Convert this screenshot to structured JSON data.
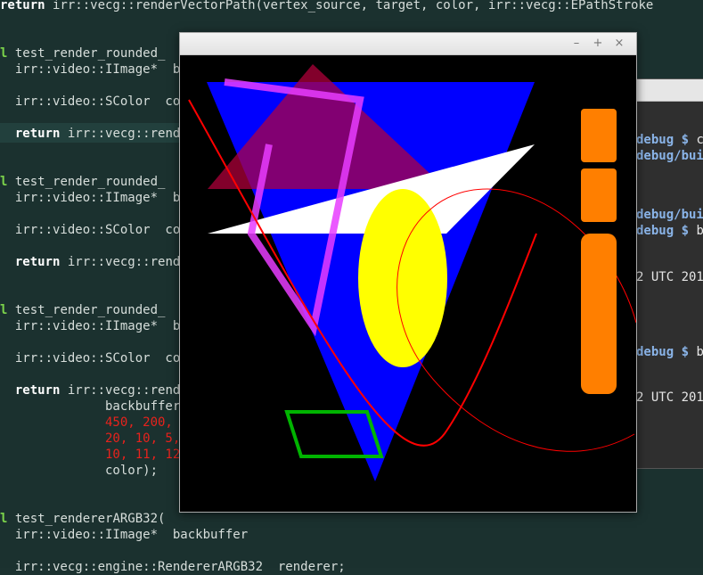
{
  "editor": {
    "lines": [
      {
        "parts": [
          {
            "cls": "kw",
            "text": "return"
          },
          {
            "text": " irr::vecg::renderVectorPath(vertex_source, target, color, irr::vecg::EPathStroke"
          }
        ]
      },
      {
        "parts": [
          {
            "cls": "kw-green",
            "text": "l"
          },
          {
            "text": " test_render_rounded_"
          }
        ]
      },
      {
        "parts": [
          {
            "text": "  irr::video::IImage*  b"
          }
        ]
      },
      {
        "parts": [
          {
            "text": "  irr::video::SColor  co"
          }
        ]
      },
      {
        "parts": [
          {
            "cls": "kw",
            "text": "  return"
          },
          {
            "text": " irr::vecg::rend"
          }
        ]
      },
      {
        "parts": [
          {
            "cls": "kw-green",
            "text": "l"
          },
          {
            "text": " test_render_rounded_"
          }
        ]
      },
      {
        "parts": [
          {
            "text": "  irr::video::IImage*  b"
          }
        ]
      },
      {
        "parts": [
          {
            "text": "  irr::video::SColor  co"
          }
        ]
      },
      {
        "parts": [
          {
            "cls": "kw",
            "text": "  return"
          },
          {
            "text": " irr::vecg::rend"
          }
        ]
      },
      {
        "parts": [
          {
            "cls": "kw-green",
            "text": "l"
          },
          {
            "text": " test_render_rounded_"
          }
        ]
      },
      {
        "parts": [
          {
            "text": "  irr::video::IImage*  b"
          }
        ]
      },
      {
        "parts": [
          {
            "text": "  irr::video::SColor  co"
          }
        ]
      },
      {
        "parts": [
          {
            "cls": "kw",
            "text": "  return"
          },
          {
            "text": " irr::vecg::rend"
          }
        ]
      },
      {
        "parts": [
          {
            "text": "              backbuffer"
          }
        ]
      },
      {
        "parts": [
          {
            "cls": "num",
            "text": "              450, 200,"
          }
        ]
      },
      {
        "parts": [
          {
            "cls": "num",
            "text": "              20, 10, 5,"
          }
        ]
      },
      {
        "parts": [
          {
            "cls": "num",
            "text": "              10, 11, 12"
          }
        ]
      },
      {
        "parts": [
          {
            "text": "              color);"
          }
        ]
      },
      {
        "parts": [
          {
            "cls": "kw-green",
            "text": "l"
          },
          {
            "text": " test_rendererARGB32("
          }
        ]
      },
      {
        "parts": [
          {
            "text": "  irr::video::IImage*  backbuffer"
          }
        ]
      },
      {
        "parts": [
          {
            "text": "  irr::vecg::engine::RendererARGB32  renderer;"
          }
        ]
      }
    ]
  },
  "terminal": {
    "lines": [
      {
        "path": "debug $ ",
        "text": "cd"
      },
      {
        "path": "debug/buil",
        "text": ""
      },
      {
        "path": "debug/buil",
        "text": ""
      },
      {
        "path": "debug $ ",
        "text": "bi"
      },
      {
        "path": "",
        "text": "2 UTC 201"
      },
      {
        "path": "debug $ ",
        "text": "bi"
      },
      {
        "path": "",
        "text": "2 UTC 201"
      }
    ]
  },
  "window": {
    "minimize_glyph": "–",
    "maximize_glyph": "+",
    "close_glyph": "×"
  },
  "colors": {
    "triangle_blue": "#0000ff",
    "triangle_red": "#b4003c",
    "white_shape": "#ffffff",
    "ellipse_yellow": "#ffff00",
    "magenta_path": "#e83cff",
    "red_curve": "#ff0000",
    "green_shape": "#00b400",
    "orange_bars": "#ff7f00"
  }
}
